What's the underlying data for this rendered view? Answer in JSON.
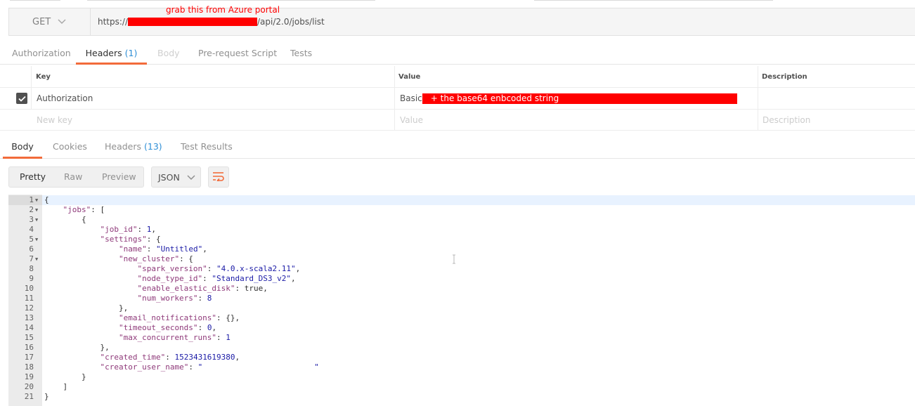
{
  "request": {
    "method": "GET",
    "url_prefix": "https://",
    "url_suffix": "/api/2.0/jobs/list",
    "annotation": "grab this from Azure portal"
  },
  "request_tabs": [
    {
      "label": "Authorization",
      "count": "",
      "state": "normal"
    },
    {
      "label": "Headers",
      "count": "(1)",
      "state": "active"
    },
    {
      "label": "Body",
      "count": "",
      "state": "disabled"
    },
    {
      "label": "Pre-request Script",
      "count": "",
      "state": "normal"
    },
    {
      "label": "Tests",
      "count": "",
      "state": "normal"
    }
  ],
  "headers_table": {
    "columns": [
      "Key",
      "Value",
      "Description"
    ],
    "rows": [
      {
        "checked": true,
        "key": "Authorization",
        "value": "Basic",
        "value_annotation": "+ the base64 enbcoded string",
        "description": ""
      }
    ],
    "new_row": {
      "key_placeholder": "New key",
      "value_placeholder": "Value",
      "description_placeholder": "Description"
    }
  },
  "response_tabs": [
    {
      "label": "Body",
      "count": "",
      "state": "active"
    },
    {
      "label": "Cookies",
      "count": "",
      "state": "normal"
    },
    {
      "label": "Headers",
      "count": "(13)",
      "state": "normal"
    },
    {
      "label": "Test Results",
      "count": "",
      "state": "normal"
    }
  ],
  "view_modes": [
    "Pretty",
    "Raw",
    "Preview"
  ],
  "active_view": "Pretty",
  "format": "JSON",
  "icons": {
    "method_dropdown": "chevron-down-icon",
    "format_dropdown": "chevron-down-icon",
    "wrap": "wrap-lines-icon",
    "checkbox": "checkmark-icon"
  },
  "colors": {
    "accent": "#f26b3a",
    "count": "#2f8fd6",
    "redaction": "#ff0000"
  },
  "code_lines": [
    {
      "n": "1",
      "fold": true,
      "text": "{"
    },
    {
      "n": "2",
      "fold": true,
      "text": "    \"jobs\": ["
    },
    {
      "n": "3",
      "fold": true,
      "text": "        {"
    },
    {
      "n": "4",
      "fold": false,
      "text": "            \"job_id\": 1,"
    },
    {
      "n": "5",
      "fold": true,
      "text": "            \"settings\": {"
    },
    {
      "n": "6",
      "fold": false,
      "text": "                \"name\": \"Untitled\","
    },
    {
      "n": "7",
      "fold": true,
      "text": "                \"new_cluster\": {"
    },
    {
      "n": "8",
      "fold": false,
      "text": "                    \"spark_version\": \"4.0.x-scala2.11\","
    },
    {
      "n": "9",
      "fold": false,
      "text": "                    \"node_type_id\": \"Standard_DS3_v2\","
    },
    {
      "n": "10",
      "fold": false,
      "text": "                    \"enable_elastic_disk\": true,"
    },
    {
      "n": "11",
      "fold": false,
      "text": "                    \"num_workers\": 8"
    },
    {
      "n": "12",
      "fold": false,
      "text": "                },"
    },
    {
      "n": "13",
      "fold": false,
      "text": "                \"email_notifications\": {},"
    },
    {
      "n": "14",
      "fold": false,
      "text": "                \"timeout_seconds\": 0,"
    },
    {
      "n": "15",
      "fold": false,
      "text": "                \"max_concurrent_runs\": 1"
    },
    {
      "n": "16",
      "fold": false,
      "text": "            },"
    },
    {
      "n": "17",
      "fold": false,
      "text": "            \"created_time\": 1523431619380,"
    },
    {
      "n": "18",
      "fold": false,
      "text": "            \"creator_user_name\": \"                        \""
    },
    {
      "n": "19",
      "fold": false,
      "text": "        }"
    },
    {
      "n": "20",
      "fold": false,
      "text": "    ]"
    },
    {
      "n": "21",
      "fold": false,
      "text": "}"
    }
  ]
}
